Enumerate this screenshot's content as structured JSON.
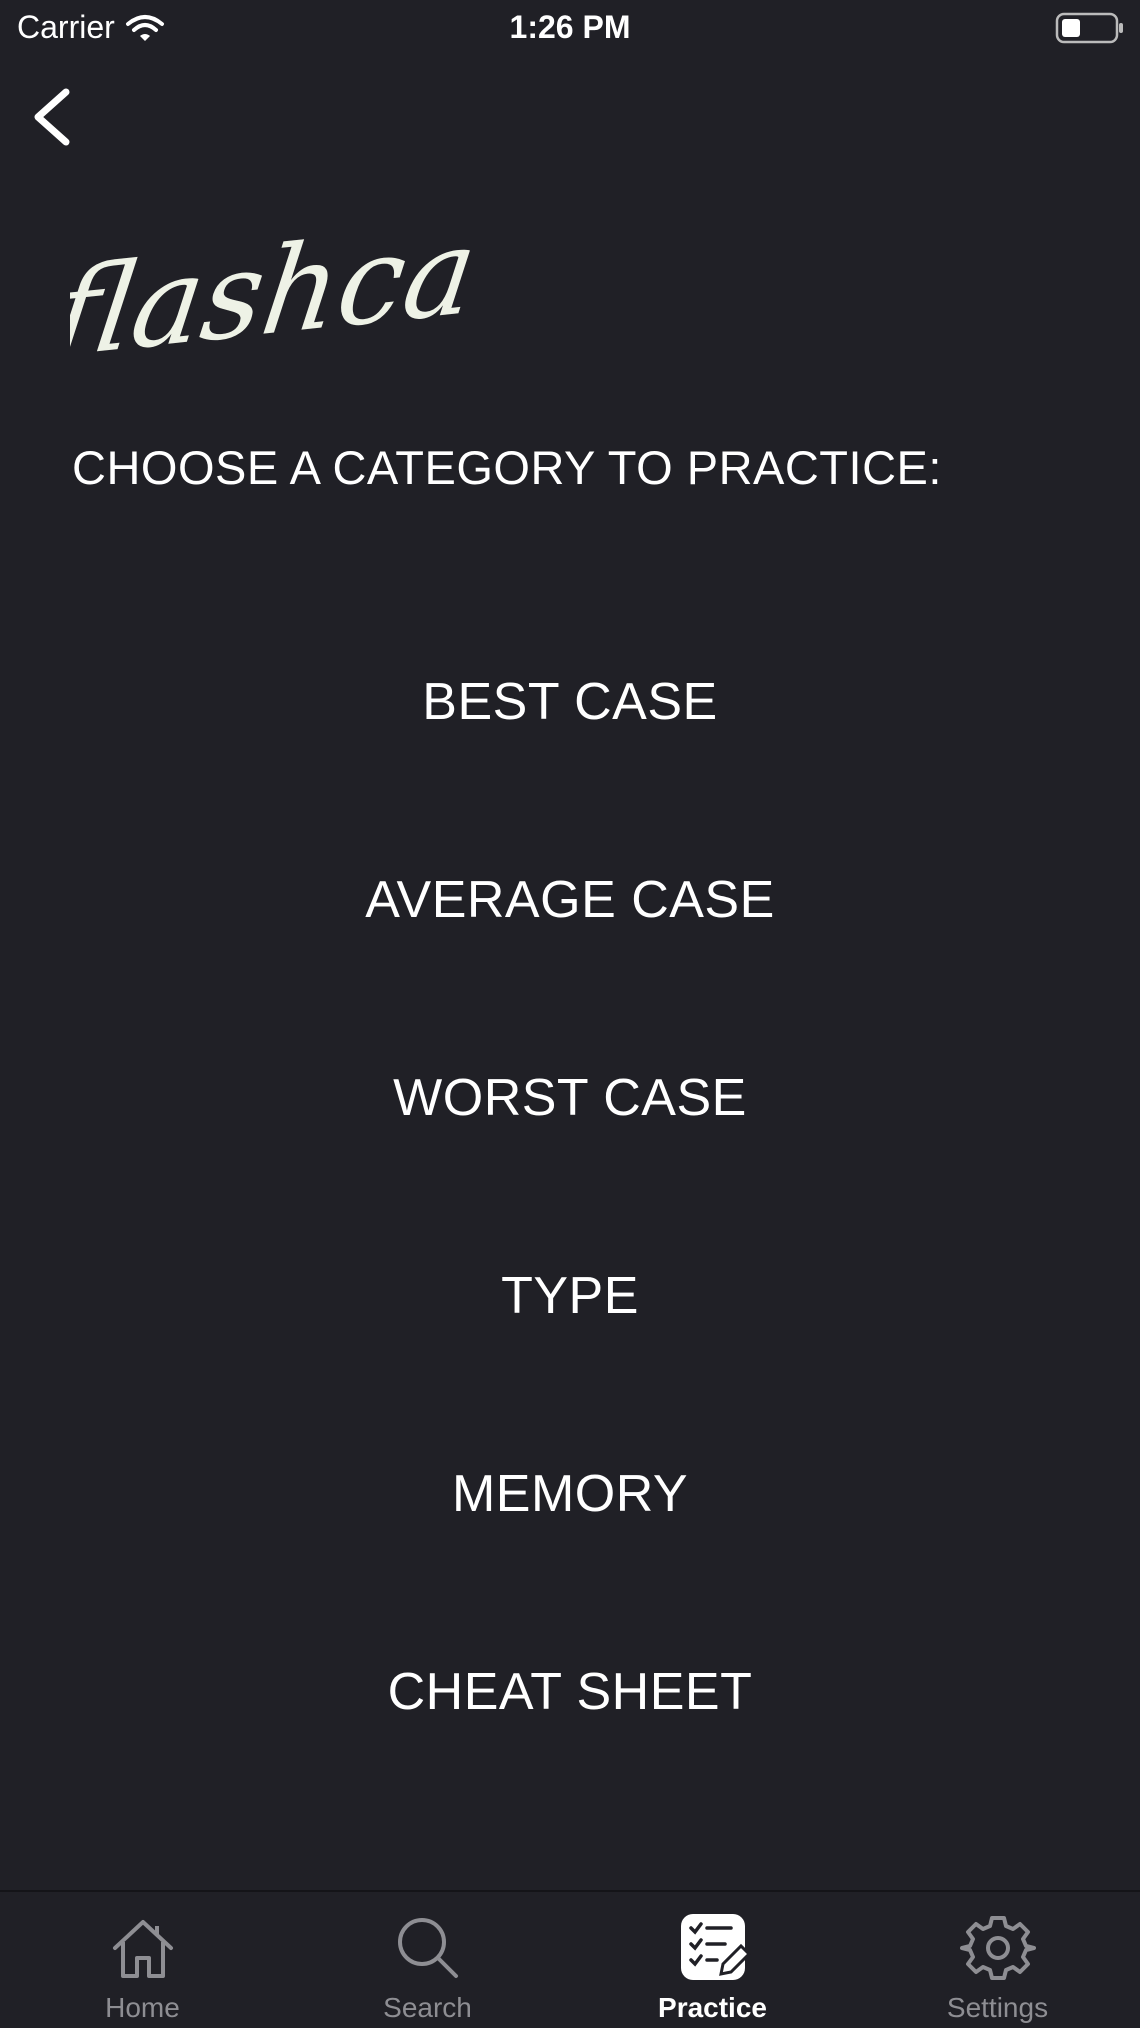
{
  "status_bar": {
    "carrier": "Carrier",
    "time": "1:26 PM",
    "battery_level": 0.35
  },
  "header": {
    "logo_text": "flashcards",
    "prompt": "CHOOSE A CATEGORY TO PRACTICE:"
  },
  "categories": [
    {
      "label": "BEST CASE"
    },
    {
      "label": "AVERAGE CASE"
    },
    {
      "label": "WORST CASE"
    },
    {
      "label": "TYPE"
    },
    {
      "label": "MEMORY"
    },
    {
      "label": "CHEAT SHEET"
    }
  ],
  "tab_bar": {
    "tabs": [
      {
        "label": "Home",
        "icon": "home-icon",
        "active": false
      },
      {
        "label": "Search",
        "icon": "search-icon",
        "active": false
      },
      {
        "label": "Practice",
        "icon": "practice-icon",
        "active": true
      },
      {
        "label": "Settings",
        "icon": "gear-icon",
        "active": false
      }
    ]
  },
  "colors": {
    "background": "#202026",
    "text": "#ffffff",
    "inactive_tab": "#8e8e93",
    "logo": "#eef2e6"
  }
}
